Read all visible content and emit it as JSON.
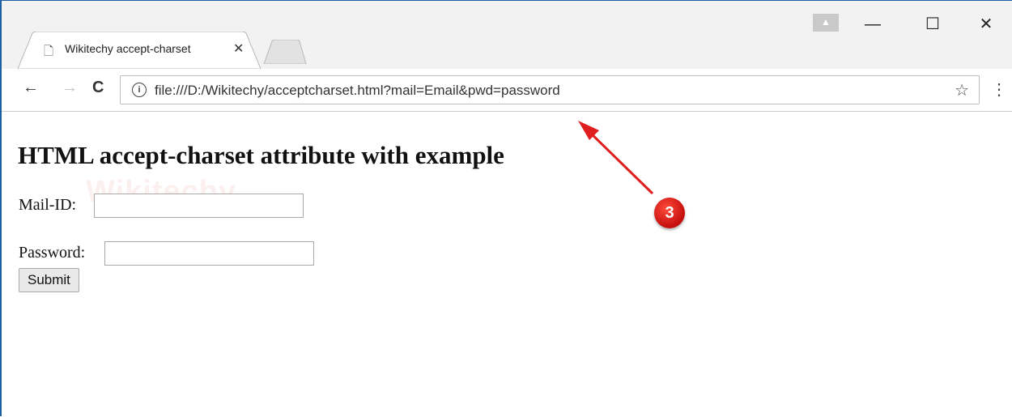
{
  "tab": {
    "title": "Wikitechy accept-charset",
    "close_glyph": "✕"
  },
  "toolbar": {
    "back_glyph": "←",
    "forward_glyph": "→",
    "reload_glyph": "C",
    "info_glyph": "i",
    "star_glyph": "☆",
    "menu_glyph": "⋮"
  },
  "address_bar": {
    "url": "file:///D:/Wikitechy/acceptcharset.html?mail=Email&pwd=password"
  },
  "window_controls": {
    "minimize": "—",
    "maximize": "☐",
    "close": "✕"
  },
  "page": {
    "heading": "HTML accept-charset attribute with example",
    "watermark": "Wikitechy",
    "mail_label": "Mail-ID:",
    "mail_value": "",
    "password_label": "Password:",
    "password_value": "",
    "submit_label": "Submit"
  },
  "annotation": {
    "badge": "3",
    "color": "#e01e1e"
  }
}
